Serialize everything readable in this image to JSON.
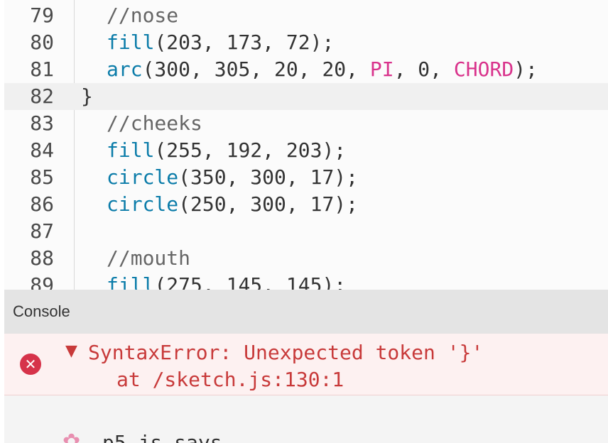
{
  "editor": {
    "lines": [
      {
        "n": "79",
        "parts": [
          {
            "t": "//nose",
            "c": "cm"
          }
        ],
        "indent": 1
      },
      {
        "n": "80",
        "parts": [
          {
            "t": "fill",
            "c": "fn"
          },
          {
            "t": "(203, 173, 72);",
            "c": ""
          }
        ],
        "indent": 1
      },
      {
        "n": "81",
        "parts": [
          {
            "t": "arc",
            "c": "fn"
          },
          {
            "t": "(300, 305, 20, 20, ",
            "c": ""
          },
          {
            "t": "PI",
            "c": "const"
          },
          {
            "t": ", 0, ",
            "c": ""
          },
          {
            "t": "CHORD",
            "c": "const"
          },
          {
            "t": ");",
            "c": ""
          }
        ],
        "indent": 1
      },
      {
        "n": "82",
        "parts": [
          {
            "t": "}",
            "c": ""
          }
        ],
        "indent": 0,
        "active": true
      },
      {
        "n": "83",
        "parts": [
          {
            "t": "//cheeks",
            "c": "cm"
          }
        ],
        "indent": 1
      },
      {
        "n": "84",
        "parts": [
          {
            "t": "fill",
            "c": "fn"
          },
          {
            "t": "(255, 192, 203);",
            "c": ""
          }
        ],
        "indent": 1
      },
      {
        "n": "85",
        "parts": [
          {
            "t": "circle",
            "c": "fn"
          },
          {
            "t": "(350, 300, 17);",
            "c": ""
          }
        ],
        "indent": 1
      },
      {
        "n": "86",
        "parts": [
          {
            "t": "circle",
            "c": "fn"
          },
          {
            "t": "(250, 300, 17);",
            "c": ""
          }
        ],
        "indent": 1
      },
      {
        "n": "87",
        "parts": [],
        "indent": 1
      },
      {
        "n": "88",
        "parts": [
          {
            "t": "//mouth",
            "c": "cm"
          }
        ],
        "indent": 1
      },
      {
        "n": "89",
        "parts": [
          {
            "t": "fill",
            "c": "fn"
          },
          {
            "t": "(275, 145, 145);",
            "c": ""
          }
        ],
        "indent": 1
      }
    ]
  },
  "console": {
    "title": "Console",
    "error": {
      "icon": "error-icon",
      "expand_icon": "triangle-down-icon",
      "message": "SyntaxError: Unexpected token '}'",
      "location": "at /sketch.js:130:1"
    },
    "footer_text": "p5.js says"
  },
  "colors": {
    "function": "#0b7ca9",
    "constant": "#d9338c",
    "comment": "#666666",
    "error": "#c83a3a",
    "error_icon": "#d6334a"
  }
}
